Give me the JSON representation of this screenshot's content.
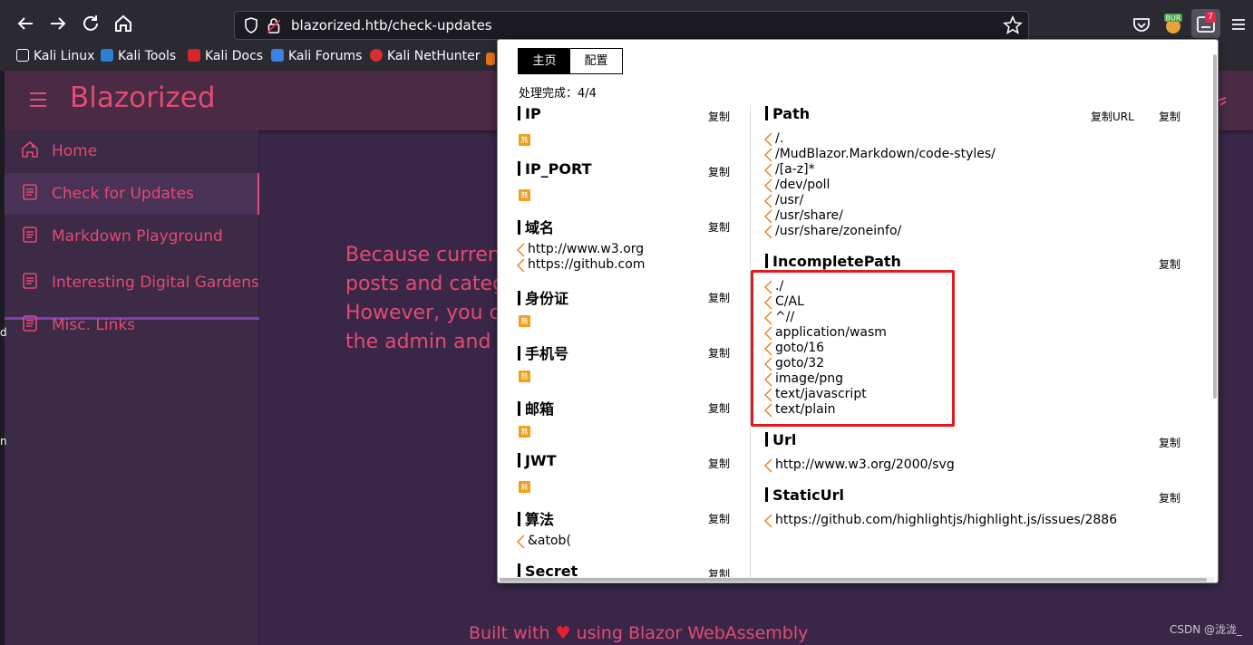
{
  "browser": {
    "url": "blazorized.htb/check-updates",
    "extension_badge": "7",
    "bookmarks": [
      "Kali Linux",
      "Kali Tools",
      "Kali Docs",
      "Kali Forums",
      "Kali NetHunter"
    ]
  },
  "app": {
    "brand": "Blazorized",
    "nav": [
      {
        "label": "Home"
      },
      {
        "label": "Check for Updates"
      },
      {
        "label": "Markdown Playground"
      },
      {
        "label": "Interesting Digital Gardens"
      },
      {
        "label": "Misc. Links"
      }
    ],
    "content_lines": [
      "Because curren",
      "posts and categ",
      "However, you c",
      "the admin and f"
    ],
    "footer": {
      "before": "Built with",
      "heart": "♥",
      "after": "using Blazor WebAssembly"
    },
    "accent_color": "#e24b73"
  },
  "popup": {
    "tabs": [
      "主页",
      "配置"
    ],
    "progress": "处理完成：4/4",
    "copy_label": "复制",
    "copy_url_label": "复制URL",
    "none_label": "無",
    "left_sections": [
      {
        "title": "IP",
        "items": []
      },
      {
        "title": "IP_PORT",
        "items": []
      },
      {
        "title": "域名",
        "items": [
          "http://www.w3.org",
          "https://github.com"
        ]
      },
      {
        "title": "身份证",
        "items": []
      },
      {
        "title": "手机号",
        "items": []
      },
      {
        "title": "邮箱",
        "items": []
      },
      {
        "title": "JWT",
        "items": []
      },
      {
        "title": "算法",
        "items": [
          "&atob("
        ]
      },
      {
        "title": "Secret",
        "items": []
      }
    ],
    "right_sections": [
      {
        "title": "Path",
        "items": [
          "/.",
          "/MudBlazor.Markdown/code-styles/",
          "/[a-z]*",
          "/dev/poll",
          "/usr/",
          "/usr/share/",
          "/usr/share/zoneinfo/"
        ]
      },
      {
        "title": "IncompletePath",
        "items": [
          "./",
          "C/AL",
          "^//",
          "application/wasm",
          "goto/16",
          "goto/32",
          "image/png",
          "text/javascript",
          "text/plain"
        ]
      },
      {
        "title": "Url",
        "items": [
          "http://www.w3.org/2000/svg"
        ]
      },
      {
        "title": "StaticUrl",
        "items": [
          "https://github.com/highlightjs/highlight.js/issues/2886"
        ]
      }
    ],
    "highlight_color": "#e5191c"
  },
  "watermark": "CSDN @泷泷_",
  "left_edge_chars": [
    "d",
    "n"
  ]
}
